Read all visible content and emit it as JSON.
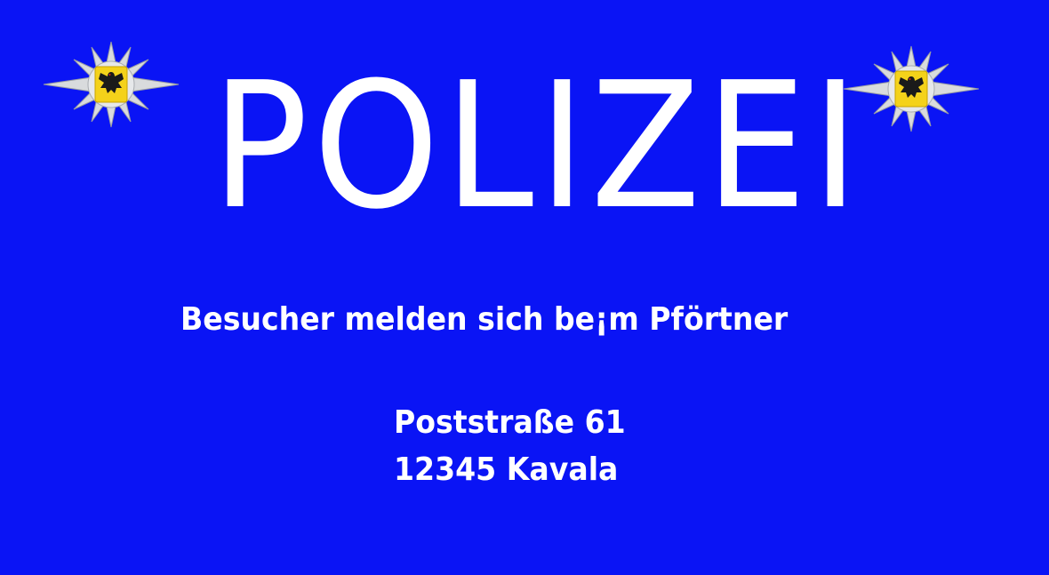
{
  "sign": {
    "title": "POLIZEI",
    "subtitle": "Besucher melden sich be¡m Pförtner",
    "address": {
      "street": "Poststraße 61",
      "city": "12345 Kavala"
    },
    "badges": [
      "police-star-eagle-badge",
      "police-star-eagle-badge"
    ]
  },
  "colors": {
    "background": "#0a14f5",
    "text": "#ffffff",
    "badge_star": "#d8dadc",
    "shield": "#f4d21a",
    "eagle": "#1a1a1a"
  }
}
